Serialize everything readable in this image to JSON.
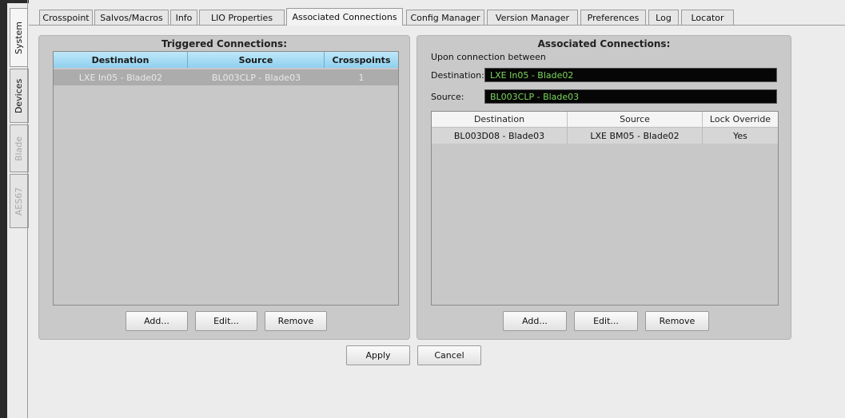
{
  "side_tabs": [
    {
      "label": "System"
    },
    {
      "label": "Devices"
    },
    {
      "label": "Blade"
    },
    {
      "label": "AES67"
    }
  ],
  "top_tabs": [
    {
      "label": "Crosspoint"
    },
    {
      "label": "Salvos/Macros"
    },
    {
      "label": "Info"
    },
    {
      "label": "LIO Properties"
    },
    {
      "label": "Associated Connections"
    },
    {
      "label": "Config Manager"
    },
    {
      "label": "Version Manager"
    },
    {
      "label": "Preferences"
    },
    {
      "label": "Log"
    },
    {
      "label": "Locator"
    }
  ],
  "triggered": {
    "title": "Triggered Connections:",
    "columns": [
      "Destination",
      "Source",
      "Crosspoints"
    ],
    "rows": [
      {
        "destination": "LXE In05 - Blade02",
        "source": "BL003CLP - Blade03",
        "crosspoints": "1"
      }
    ],
    "buttons": {
      "add": "Add...",
      "edit": "Edit...",
      "remove": "Remove"
    }
  },
  "associated": {
    "title": "Associated Connections:",
    "subtitle": "Upon connection between",
    "destination_label": "Destination:",
    "destination_value": "LXE In05 - Blade02",
    "source_label": "Source:",
    "source_value": "BL003CLP - Blade03",
    "columns": [
      "Destination",
      "Source",
      "Lock Override"
    ],
    "rows": [
      {
        "destination": "BL003D08 - Blade03",
        "source": "LXE BM05 - Blade02",
        "lock_override": "Yes"
      }
    ],
    "buttons": {
      "add": "Add...",
      "edit": "Edit...",
      "remove": "Remove"
    }
  },
  "footer": {
    "apply": "Apply",
    "cancel": "Cancel"
  }
}
